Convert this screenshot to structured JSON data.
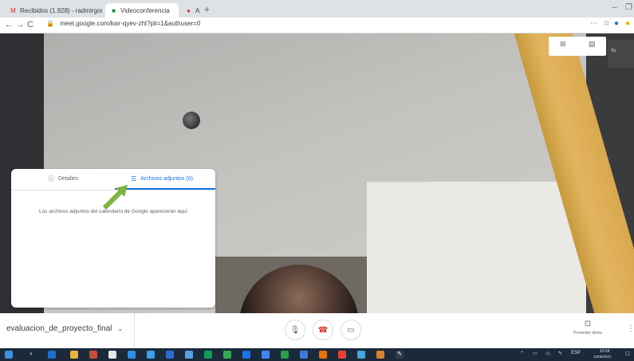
{
  "browser": {
    "tabs": [
      {
        "title": "Recibidos (1.928) - radmirgor...",
        "icon": "gmail-icon",
        "active": false
      },
      {
        "title": "Videoconferencia",
        "icon": "meet-icon",
        "active": true
      },
      {
        "title": "A",
        "icon": "recording-icon",
        "active": false
      }
    ],
    "new_tab": "+",
    "url": "meet.google.com/kwr-qyev-zht?pli=1&authuser=0",
    "nav": {
      "back": "←",
      "forward": "→",
      "reload": "C"
    },
    "window_controls": [
      "–",
      "❐"
    ],
    "toolbar_icons": [
      "⋯",
      "☆",
      "●",
      "●"
    ]
  },
  "meeting": {
    "self_label": "Tú",
    "top_controls": [
      "caption-icon",
      "layout-icon"
    ],
    "panel": {
      "tab_details": "Detalles",
      "tab_attachments": "Archivos adjuntos (0)",
      "message": "Los archivos adjuntos del calendario de Google aparecerán aquí"
    },
    "meeting_name": "evaluacion_de_proyecto_final",
    "controls": {
      "mic": "🎙",
      "hangup": "☎",
      "camera": "▭"
    },
    "present": {
      "label": "Presentar ahora"
    },
    "more": "⋮"
  },
  "colors": {
    "accent": "#1a73e8",
    "arrow": "#7cb342",
    "hangup": "#d93025",
    "taskbar": "#1b2a3a"
  },
  "taskbar": {
    "tray_time": "10:54",
    "tray_date": "12/05/2021",
    "tray_lang": "ESP"
  }
}
